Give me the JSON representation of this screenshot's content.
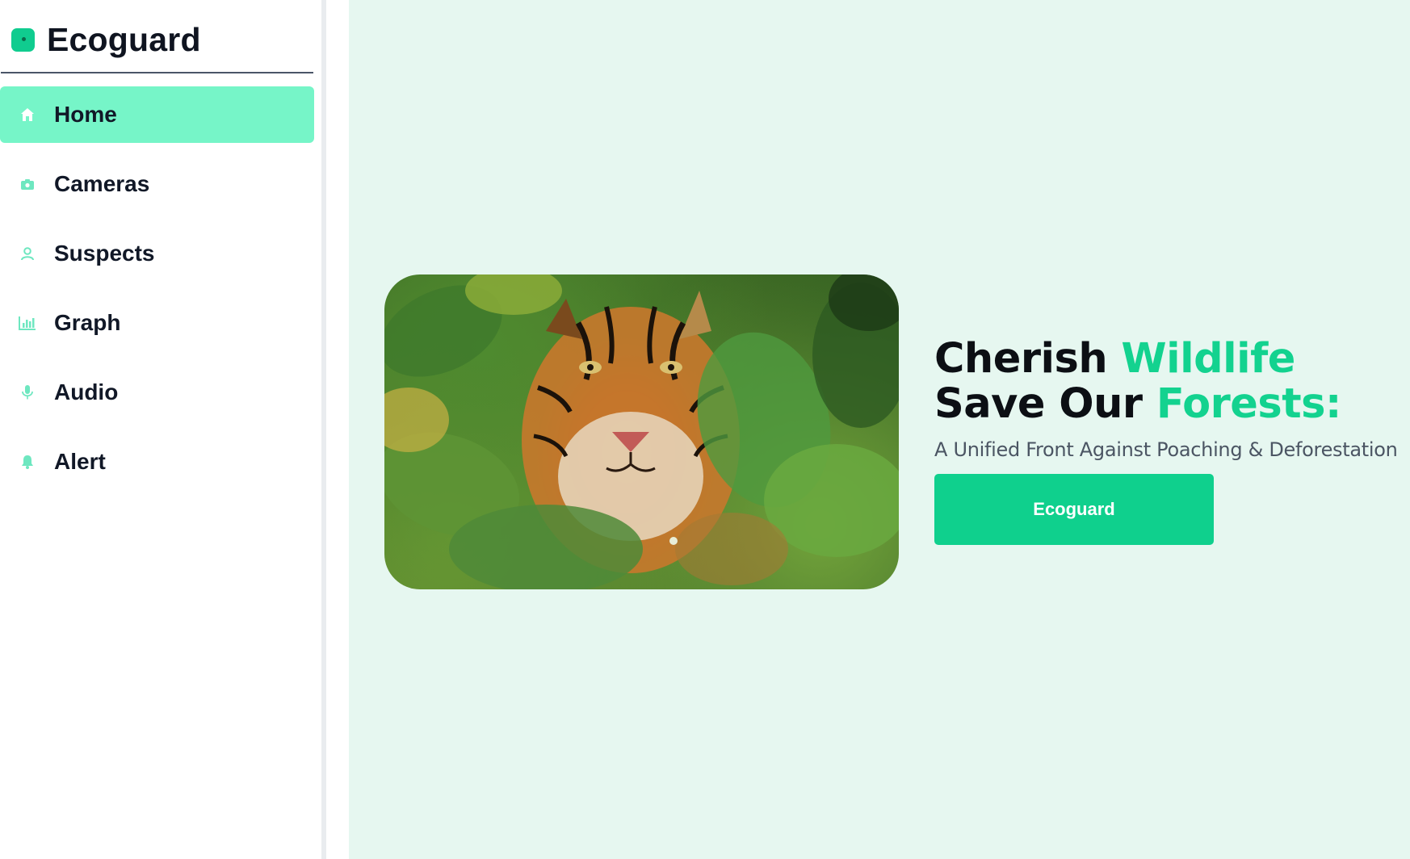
{
  "app": {
    "brand_name": "Ecoguard",
    "accent_color": "#10cc8f",
    "logo_icon": "leaf-logo-icon"
  },
  "sidebar": {
    "active_item": "Home",
    "items": [
      {
        "label": "Home",
        "icon": "home-icon",
        "active": true
      },
      {
        "label": "Cameras",
        "icon": "camera-icon",
        "active": false
      },
      {
        "label": "Suspects",
        "icon": "user-icon",
        "active": false
      },
      {
        "label": "Graph",
        "icon": "bar-chart-icon",
        "active": false
      },
      {
        "label": "Audio",
        "icon": "microphone-icon",
        "active": false
      },
      {
        "label": "Alert",
        "icon": "bell-icon",
        "active": false
      }
    ]
  },
  "hero": {
    "title_part1": "Cherish ",
    "title_accent1": "Wildlife",
    "title_part2": " Save Our ",
    "title_accent2": "Forests:",
    "subtitle": "A Unified Front Against Poaching & Deforestation",
    "cta_label": "Ecoguard",
    "image_subject": "tiger-in-foliage"
  },
  "colors": {
    "background": "#e6f7f0",
    "active_nav": "#76f5c8",
    "title_accent": "#13d28f",
    "button": "#0fd08d"
  }
}
